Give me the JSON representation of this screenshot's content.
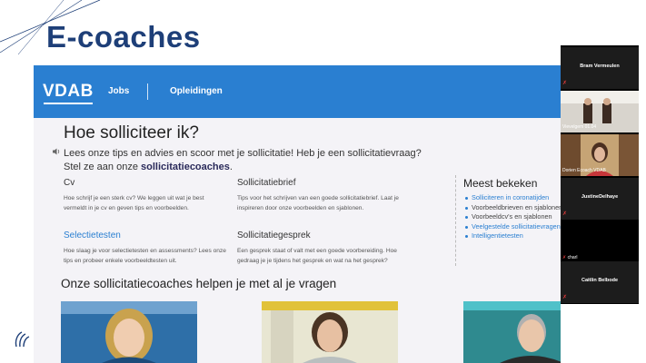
{
  "slide": {
    "title": "E-coaches"
  },
  "vdab": {
    "logo_text": "VDAB",
    "nav": [
      "Jobs",
      "Opleidingen"
    ],
    "heading": "Hoe solliciteer ik?",
    "intro_line1": "Lees onze tips en advies en scoor met je sollicitatie! Heb je een sollicitatievraag?",
    "intro_line2_prefix": "Stel ze aan onze ",
    "intro_line2_bold": "sollicitatiecoaches",
    "intro_line2_suffix": ".",
    "topics": [
      {
        "title": "Cv",
        "link": false,
        "text": "Hoe schrijf je een sterk cv? We leggen uit wat je best vermeldt in je cv en geven tips en voorbeelden."
      },
      {
        "title": "Sollicitatiebrief",
        "link": false,
        "text": "Tips voor het schrijven van een goede sollicitatiebrief. Laat je inspireren door onze voorbeelden en sjablonen."
      },
      {
        "title": "Selectietesten",
        "link": true,
        "text": "Hoe slaag je voor selectietesten en assessments? Lees onze tips en probeer enkele voorbeeldtesten uit."
      },
      {
        "title": "Sollicitatiegesprek",
        "link": false,
        "text": "Een gesprek staat of valt met een goede voorbereiding. Hoe gedraag je je tijdens het gesprek en wat na het gesprek?"
      }
    ],
    "most_viewed": {
      "title": "Meest bekeken",
      "items": [
        {
          "label": "Solliciteren in coronatijden",
          "link": true
        },
        {
          "label": "Voorbeeldbrieven en sjablonen",
          "link": false
        },
        {
          "label": "Voorbeeldcv's en sjablonen",
          "link": false
        },
        {
          "label": "Veelgestelde sollicitatievragen",
          "link": true
        },
        {
          "label": "Intelligentietesten",
          "link": true
        }
      ]
    },
    "coaches_heading": "Onze sollicitatiecoaches helpen je met al je vragen"
  },
  "participants": [
    {
      "name": "Bram Vermeulen",
      "video": false,
      "muted": true,
      "label": ""
    },
    {
      "name": "",
      "video": true,
      "muted": false,
      "label": "Vievelgem 01.04"
    },
    {
      "name": "",
      "video": true,
      "muted": false,
      "label": "Dorien Ecoach VDAB"
    },
    {
      "name": "JustineDelhaye",
      "video": false,
      "muted": true,
      "label": ""
    },
    {
      "name": "",
      "video": false,
      "muted": true,
      "label": "charl"
    },
    {
      "name": "Caitlin Belbode",
      "video": false,
      "muted": true,
      "label": ""
    }
  ]
}
